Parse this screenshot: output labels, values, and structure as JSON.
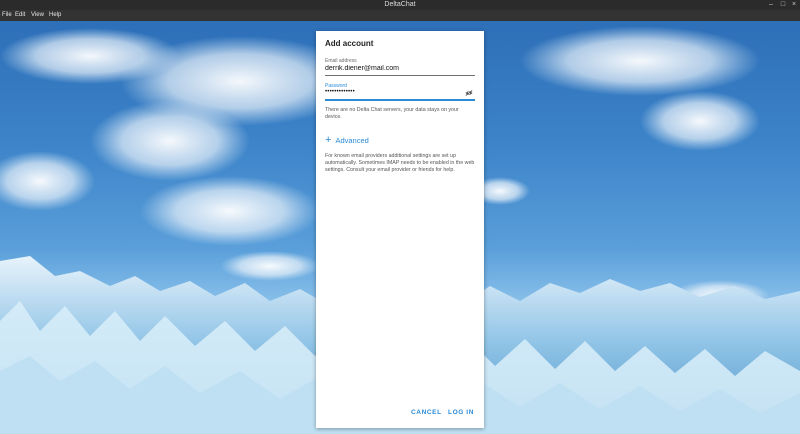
{
  "window": {
    "title": "DeltaChat"
  },
  "menu": [
    "File",
    "Edit",
    "View",
    "Help"
  ],
  "dialog": {
    "title": "Add account",
    "email": {
      "label": "Email address",
      "value": "derrik.diener@mail.com"
    },
    "password": {
      "label": "Password",
      "value": "•••••••••••••"
    },
    "info": "There are no Delta Chat servers, your data stays on your device.",
    "advanced_label": "Advanced",
    "help": "For known email providers additional settings are set up automatically. Sometimes IMAP needs to be enabled in the web settings. Consult your email provider or friends for help.",
    "cancel_label": "CANCEL",
    "login_label": "LOG IN"
  },
  "colors": {
    "accent": "#2b8ad6",
    "titlebar": "#2b2b2b",
    "menubar": "#333333"
  }
}
